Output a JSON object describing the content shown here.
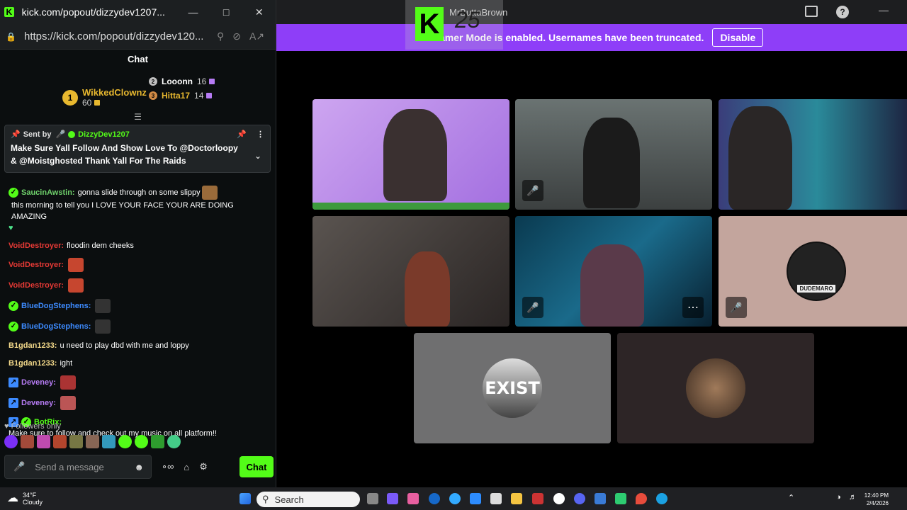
{
  "popout": {
    "title": "kick.com/popout/dizzydev1207...",
    "url": "https://kick.com/popout/dizzydev120...",
    "chat_heading": "Chat",
    "leaderboard": [
      {
        "rank": "1",
        "name": "WikkedClownz",
        "value": "60"
      },
      {
        "rank": "2",
        "name": "Looonn",
        "value": "16"
      },
      {
        "rank": "3",
        "name": "Hitta17",
        "value": "14"
      }
    ],
    "pinned": {
      "sent_by_label": "Sent by",
      "author": "DizzyDev1207",
      "message": "Make Sure Yall Follow And Show Love To @Doctorloopy & @Moistghosted Thank Yall For The Raids"
    },
    "messages": [
      {
        "user": "SaucinAwstin:",
        "color": "#6fd06b",
        "text": "gonna slide through on some slippy",
        "text2": "this morning to tell you I LOVE YOUR FACE YOUR ARE DOING AMAZING"
      },
      {
        "user": "VoidDestroyer:",
        "color": "#e53935",
        "text": "floodin dem cheeks"
      },
      {
        "user": "VoidDestroyer:",
        "color": "#e53935",
        "text": ""
      },
      {
        "user": "VoidDestroyer:",
        "color": "#e53935",
        "text": ""
      },
      {
        "user": "BlueDogStephens:",
        "color": "#3d8bff",
        "text": ""
      },
      {
        "user": "BlueDogStephens:",
        "color": "#3d8bff",
        "text": ""
      },
      {
        "user": "B1gdan1233:",
        "color": "#f3d98a",
        "text": "u need to play dbd with me and loppy"
      },
      {
        "user": "B1gdan1233:",
        "color": "#f3d98a",
        "text": "ight"
      },
      {
        "user": "Deveney:",
        "color": "#b77cf5",
        "text": ""
      },
      {
        "user": "Deveney:",
        "color": "#b77cf5",
        "text": ""
      },
      {
        "user": "BotRix:",
        "color": "#53fc18",
        "text": "Make sure to follow and check out my music on all platform!!"
      }
    ],
    "followers_only": "Followers only",
    "input_placeholder": "Send a message",
    "chat_button": "Chat"
  },
  "main": {
    "streamer_name": "MrButtaBrown",
    "overlay_number": "25",
    "banner_text": "Streamer Mode is enabled. Usernames have been truncated.",
    "disable_button": "Disable",
    "avatar_labels": [
      "DUDEMARO",
      "EXIST"
    ]
  },
  "taskbar": {
    "temperature": "34°F",
    "condition": "Cloudy",
    "search_placeholder": "Search",
    "time": "12:40 PM",
    "date": "2/4/2026"
  }
}
